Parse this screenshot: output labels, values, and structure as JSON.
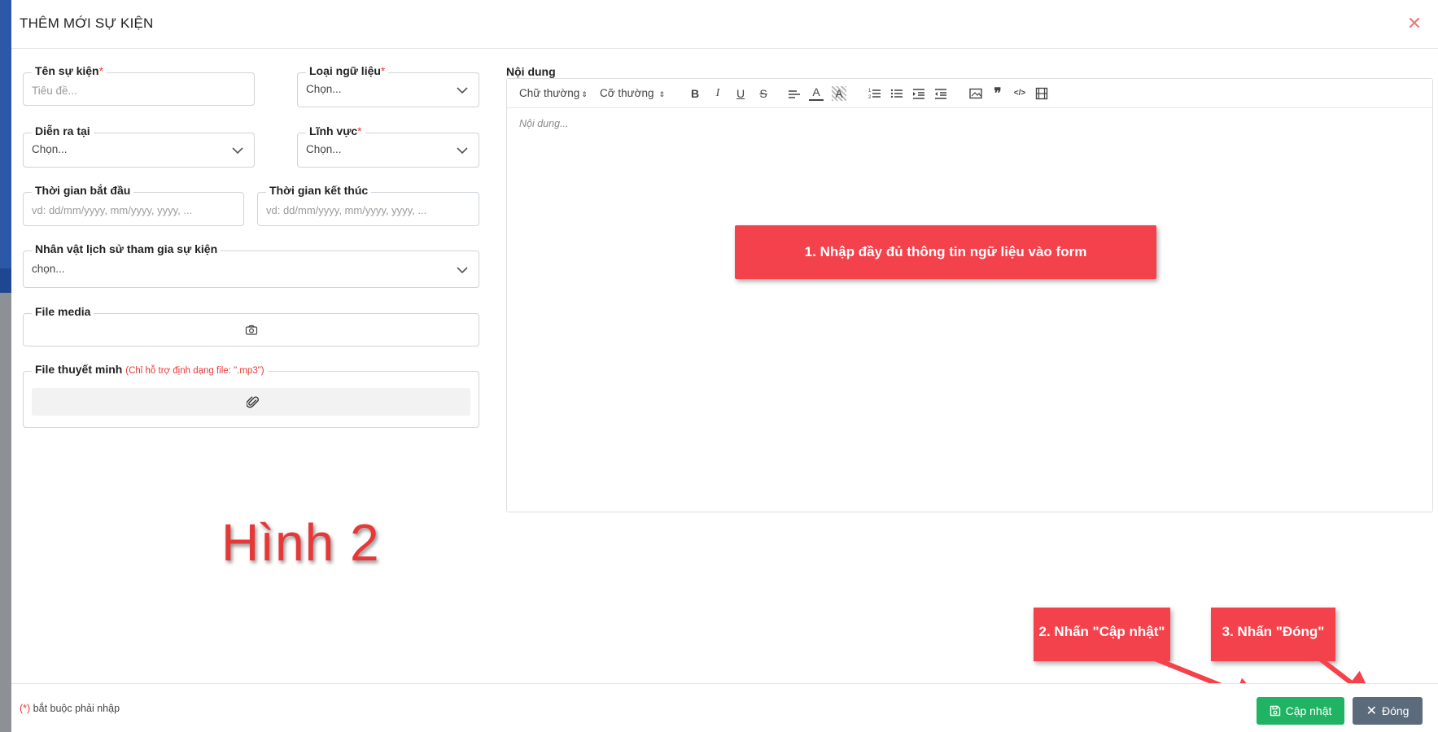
{
  "modal": {
    "title": "THÊM MỚI SỰ KIỆN"
  },
  "form": {
    "ten_su_kien": {
      "label": "Tên sự kiện",
      "required": "*",
      "placeholder": "Tiêu đề..."
    },
    "loai_ngu_lieu": {
      "label": "Loại ngữ liệu",
      "required": "*",
      "value": "Chọn..."
    },
    "dien_ra_tai": {
      "label": "Diễn ra tại",
      "value": "Chọn..."
    },
    "linh_vuc": {
      "label": "Lĩnh vực",
      "required": "*",
      "value": "Chọn..."
    },
    "thoi_gian_bat_dau": {
      "label": "Thời gian bắt đầu",
      "placeholder": "vd: dd/mm/yyyy, mm/yyyy, yyyy, ..."
    },
    "thoi_gian_ket_thuc": {
      "label": "Thời gian kết thúc",
      "placeholder": "vd: dd/mm/yyyy, mm/yyyy, yyyy, ..."
    },
    "nhan_vat": {
      "label": "Nhân vật lịch sử tham gia sự kiện",
      "value": "chọn..."
    },
    "file_media": {
      "label": "File media",
      "icon": "camera-icon"
    },
    "file_thuyet_minh": {
      "label": "File thuyết minh",
      "note": "(Chỉ hỗ trợ định dạng file: \".mp3\")",
      "icon": "paperclip-icon"
    }
  },
  "editor": {
    "label": "Nội dung",
    "font_select": "Chữ thường",
    "size_select": "Cỡ thường",
    "toolbar_icons": [
      "bold-icon",
      "italic-icon",
      "underline-icon",
      "strikethrough-icon",
      "align-icon",
      "text-color-icon",
      "highlight-icon",
      "ordered-list-icon",
      "bullet-list-icon",
      "indent-icon",
      "outdent-icon",
      "image-icon",
      "blockquote-icon",
      "code-icon",
      "video-icon"
    ],
    "placeholder": "Nội dung..."
  },
  "callouts": {
    "step1": "1. Nhập đầy đủ thông tin ngữ liệu vào form",
    "step2": "2. Nhấn \"Cập nhật\"",
    "step3": "3. Nhấn \"Đóng\""
  },
  "caption": "Hình 2",
  "footer": {
    "required_mark": "(*)",
    "required_note": " bắt buộc phải nhập",
    "save_label": "Cập nhật",
    "close_label": "Đóng"
  },
  "colors": {
    "accent_red": "#f4424c",
    "save_green": "#20b364",
    "close_gray": "#5b6b7c",
    "required_red": "#e53935"
  }
}
